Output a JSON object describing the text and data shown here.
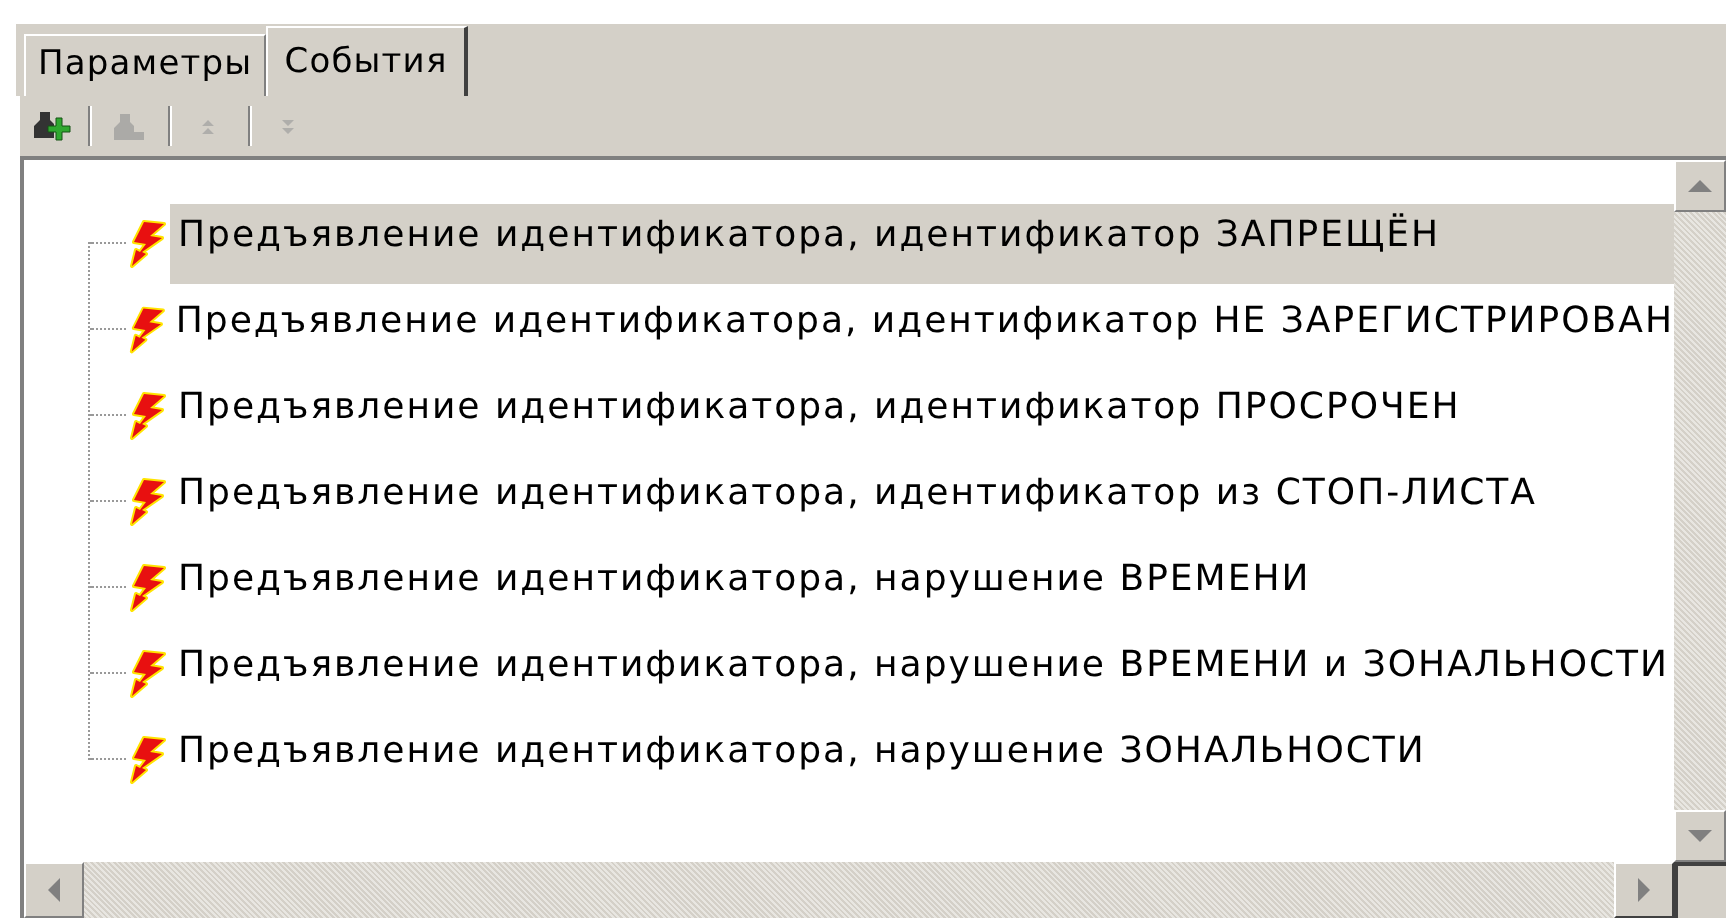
{
  "tabs": [
    {
      "label": "Параметры",
      "selected": false
    },
    {
      "label": "События",
      "selected": true
    }
  ],
  "toolbar": [
    {
      "kind": "add",
      "disabled": false
    },
    {
      "kind": "remove",
      "disabled": true
    },
    {
      "kind": "up",
      "disabled": true
    },
    {
      "kind": "down",
      "disabled": true
    }
  ],
  "tree": {
    "items": [
      {
        "label": "Предъявление идентификатора, идентификатор ЗАПРЕЩЁН",
        "selected": true
      },
      {
        "label": "Предъявление идентификатора, идентификатор НЕ ЗАРЕГИСТРИРОВАН",
        "selected": false
      },
      {
        "label": "Предъявление идентификатора, идентификатор ПРОСРОЧЕН",
        "selected": false
      },
      {
        "label": "Предъявление идентификатора, идентификатор из СТОП-ЛИСТА",
        "selected": false
      },
      {
        "label": "Предъявление идентификатора, нарушение ВРЕМЕНИ",
        "selected": false
      },
      {
        "label": "Предъявление идентификатора, нарушение ВРЕМЕНИ и ЗОНАЛЬНОСТИ",
        "selected": false
      },
      {
        "label": "Предъявление идентификатора, нарушение ЗОНАЛЬНОСТИ",
        "selected": false
      }
    ]
  }
}
